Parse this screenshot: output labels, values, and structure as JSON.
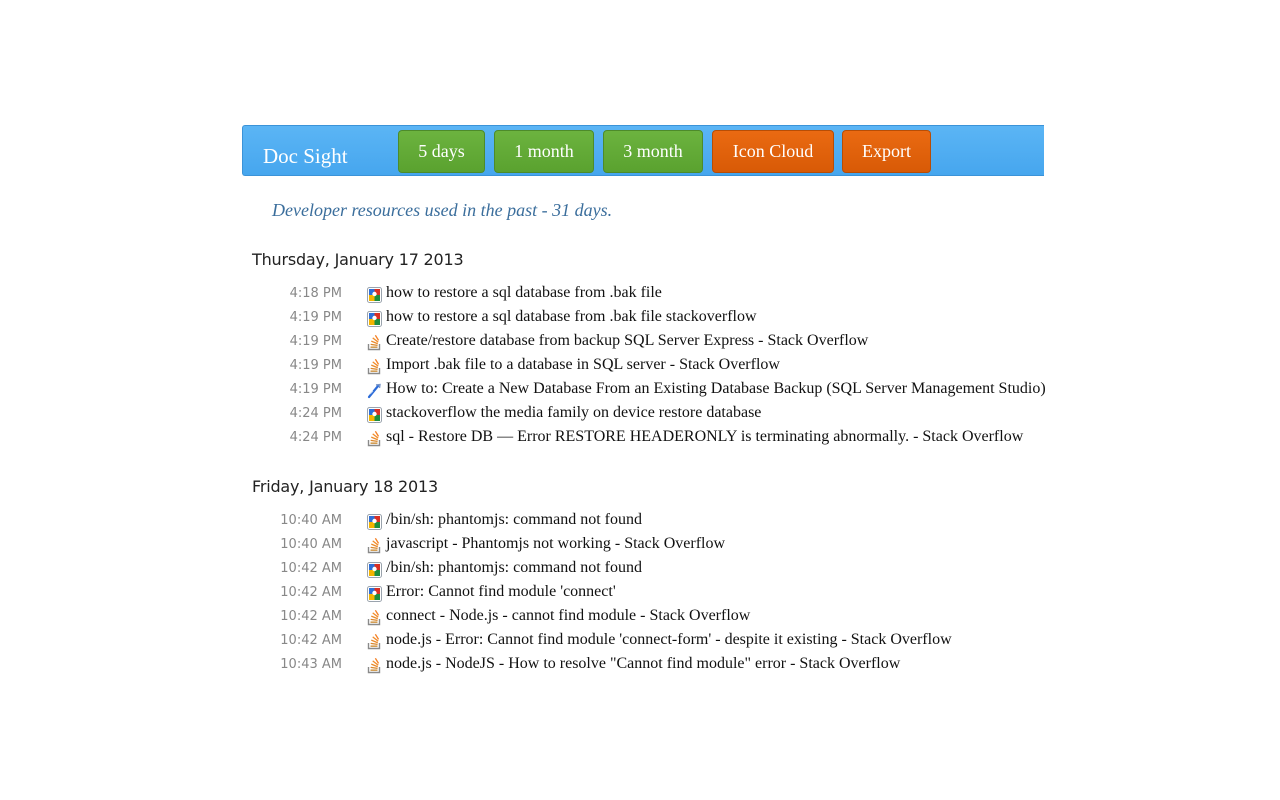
{
  "header": {
    "brand": "Doc Sight",
    "buttons": [
      {
        "label": "5 days",
        "color": "#5fa836"
      },
      {
        "label": "1 month",
        "color": "#5fa836"
      },
      {
        "label": "3 month",
        "color": "#5fa836"
      },
      {
        "label": "Icon Cloud",
        "color": "#e0600a"
      },
      {
        "label": "Export",
        "color": "#e0600a"
      }
    ]
  },
  "subtitle": "Developer resources used in the past - 31 days.",
  "days": [
    {
      "heading": "Thursday, January 17 2013",
      "entries": [
        {
          "time": "4:18 PM",
          "icon": "google-icon",
          "title": "how to restore a sql database from .bak file"
        },
        {
          "time": "4:19 PM",
          "icon": "google-icon",
          "title": "how to restore a sql database from .bak file stackoverflow"
        },
        {
          "time": "4:19 PM",
          "icon": "stackoverflow-icon",
          "title": "Create/restore database from backup SQL Server Express - Stack Overflow"
        },
        {
          "time": "4:19 PM",
          "icon": "stackoverflow-icon",
          "title": "Import .bak file to a database in SQL server - Stack Overflow"
        },
        {
          "time": "4:19 PM",
          "icon": "msdn-icon",
          "title": "How to: Create a New Database From an Existing Database Backup (SQL Server Management Studio)"
        },
        {
          "time": "4:24 PM",
          "icon": "google-icon",
          "title": "stackoverflow the media family on device restore database"
        },
        {
          "time": "4:24 PM",
          "icon": "stackoverflow-icon",
          "title": "sql - Restore DB — Error RESTORE HEADERONLY is terminating abnormally. - Stack Overflow"
        }
      ]
    },
    {
      "heading": "Friday, January 18 2013",
      "entries": [
        {
          "time": "10:40 AM",
          "icon": "google-icon",
          "title": "/bin/sh: phantomjs: command not found"
        },
        {
          "time": "10:40 AM",
          "icon": "stackoverflow-icon",
          "title": "javascript - Phantomjs not working - Stack Overflow"
        },
        {
          "time": "10:42 AM",
          "icon": "google-icon",
          "title": "/bin/sh: phantomjs: command not found"
        },
        {
          "time": "10:42 AM",
          "icon": "google-icon",
          "title": "Error: Cannot find module 'connect'"
        },
        {
          "time": "10:42 AM",
          "icon": "stackoverflow-icon",
          "title": "connect - Node.js - cannot find module - Stack Overflow"
        },
        {
          "time": "10:42 AM",
          "icon": "stackoverflow-icon",
          "title": "node.js - Error: Cannot find module 'connect-form' - despite it existing - Stack Overflow"
        },
        {
          "time": "10:43 AM",
          "icon": "stackoverflow-icon",
          "title": "node.js - NodeJS - How to resolve \"Cannot find module\" error - Stack Overflow"
        }
      ]
    }
  ]
}
